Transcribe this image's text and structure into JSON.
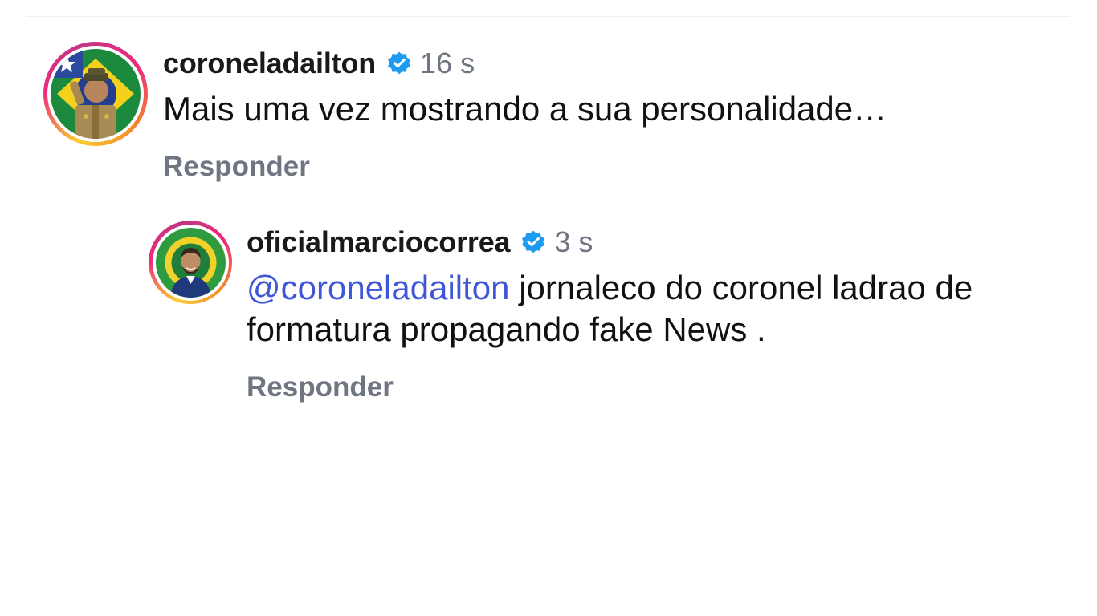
{
  "comments": [
    {
      "username": "coroneladailton",
      "verified_icon": "verified-badge-icon",
      "time": "16 s",
      "text": "Mais uma vez mostrando a sua personalidade…",
      "reply_label": "Responder",
      "avatar": "profile-photo"
    }
  ],
  "reply": {
    "username": "oficialmarciocorrea",
    "verified_icon": "verified-badge-icon",
    "time": "3 s",
    "mention": "@coroneladailton",
    "text": "jornaleco do coronel ladrao de formatura propagando fake News .",
    "reply_label": "Responder",
    "avatar": "profile-photo"
  },
  "colors": {
    "verified_blue": "#1d9bf0",
    "mention_blue": "#3f56d6",
    "muted_gray": "#6e7480",
    "story_ring": [
      "#f9ce34",
      "#ee2a7b",
      "#c13584",
      "#f58529"
    ]
  }
}
